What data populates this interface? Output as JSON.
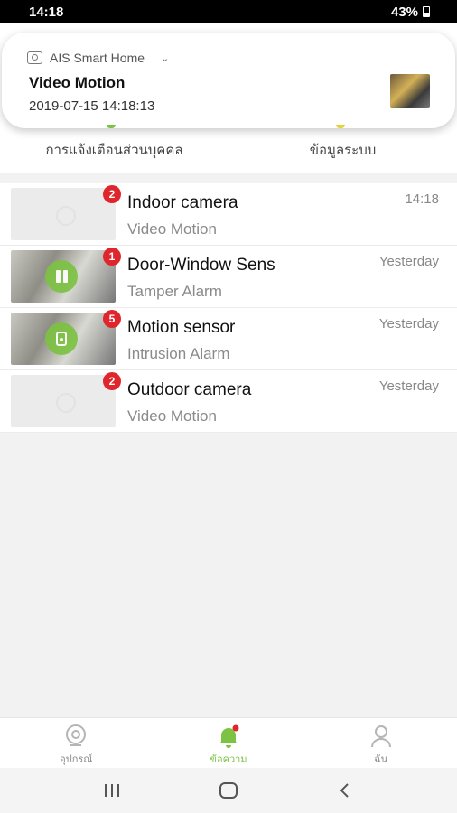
{
  "status_bar": {
    "time": "14:18",
    "battery": "43%"
  },
  "notification": {
    "app_name": "AIS Smart Home",
    "title": "Video Motion",
    "timestamp": "2019-07-15 14:18:13"
  },
  "tabs": [
    {
      "label": "การแจ้งเตือนส่วนบุคคล"
    },
    {
      "label": "ข้อมูลระบบ"
    }
  ],
  "messages": [
    {
      "title": "Indoor camera",
      "subtitle": "Video Motion",
      "time": "14:18",
      "badge": "2",
      "device": "camera"
    },
    {
      "title": "Door-Window Sens",
      "subtitle": "Tamper Alarm",
      "time": "Yesterday",
      "badge": "1",
      "device": "door"
    },
    {
      "title": "Motion sensor",
      "subtitle": "Intrusion Alarm",
      "time": "Yesterday",
      "badge": "5",
      "device": "motion"
    },
    {
      "title": "Outdoor camera",
      "subtitle": "Video Motion",
      "time": "Yesterday",
      "badge": "2",
      "device": "camera"
    }
  ],
  "bottom_nav": [
    {
      "label": "อุปกรณ์",
      "icon": "camera-icon",
      "active": false
    },
    {
      "label": "ข้อความ",
      "icon": "bell-icon",
      "active": true
    },
    {
      "label": "ฉัน",
      "icon": "person-icon",
      "active": false
    }
  ],
  "colors": {
    "accent": "#7cc243",
    "badge": "#e0262d"
  }
}
